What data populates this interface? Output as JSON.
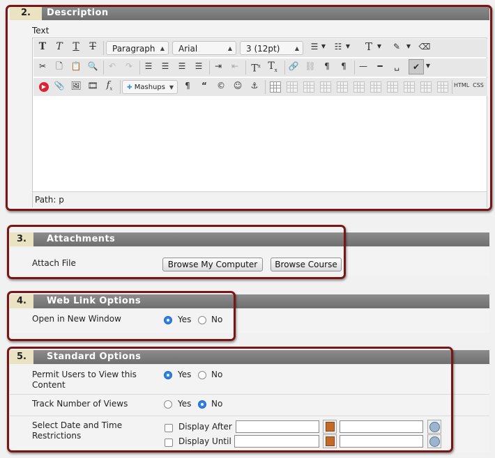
{
  "sections": {
    "description": {
      "number": "2.",
      "title": "Description"
    },
    "attachments": {
      "number": "3.",
      "title": "Attachments"
    },
    "weblink": {
      "number": "4.",
      "title": "Web Link Options"
    },
    "standard": {
      "number": "5.",
      "title": "Standard Options"
    }
  },
  "editor": {
    "label": "Text",
    "path_label": "Path: p",
    "format_select": "Paragraph",
    "font_select": "Arial",
    "size_select": "3 (12pt)",
    "mashups_label": "Mashups",
    "html_label": "HTML",
    "css_label": "CSS",
    "row1_icons": [
      "bold-icon",
      "italic-icon",
      "underline-icon",
      "strikethrough-icon"
    ],
    "row2_icons": [
      "cut-icon",
      "copy-icon",
      "paste-icon",
      "find-icon",
      "undo-icon",
      "redo-icon",
      "align-left-icon",
      "align-center-icon",
      "align-right-icon",
      "align-justify-icon",
      "indent-icon",
      "outdent-icon",
      "superscript-icon",
      "subscript-icon",
      "link-icon",
      "unlink-icon",
      "ltr-icon",
      "rtl-icon",
      "hr-icon",
      "hr-thick-icon",
      "space-icon",
      "spellcheck-icon"
    ],
    "row3_icons": [
      "youtube-icon",
      "attach-icon",
      "image-icon",
      "media-icon",
      "formula-icon",
      "mashups-icon",
      "paragraph-mark-icon",
      "quote-icon",
      "copyright-icon",
      "emoticon-icon",
      "anchor-icon",
      "table-icon"
    ]
  },
  "attachments": {
    "label": "Attach File",
    "browse_computer": "Browse My Computer",
    "browse_course": "Browse Course"
  },
  "weblink": {
    "label": "Open in New Window",
    "yes": "Yes",
    "no": "No",
    "selected": "Yes"
  },
  "standard": {
    "permit_label": "Permit Users to View this Content",
    "permit_selected": "Yes",
    "track_label": "Track Number of Views",
    "track_selected": "No",
    "yes": "Yes",
    "no": "No",
    "date_label": "Select Date and Time Restrictions",
    "display_after": "Display After",
    "display_until": "Display Until"
  }
}
